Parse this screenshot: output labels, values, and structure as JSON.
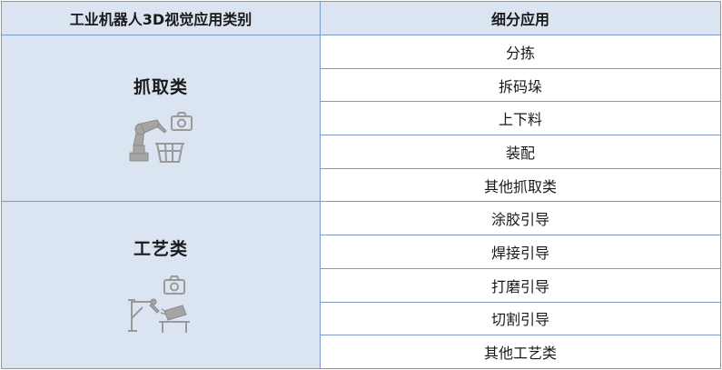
{
  "header": {
    "col1": "工业机器人3D视觉应用类别",
    "col2": "细分应用"
  },
  "categories": [
    {
      "name": "抓取类",
      "icon": "robot-arm-grabbing-basket-icon",
      "items": [
        "分拣",
        "拆码垛",
        "上下料",
        "装配",
        "其他抓取类"
      ]
    },
    {
      "name": "工艺类",
      "icon": "robot-arm-processing-workpiece-icon",
      "items": [
        "涂胶引导",
        "焊接引导",
        "打磨引导",
        "切割引导",
        "其他工艺类"
      ]
    }
  ],
  "colors": {
    "header_bg": "#dbe4f1",
    "border": "#7f99c6",
    "icon_gray": "#9a9a9a"
  }
}
